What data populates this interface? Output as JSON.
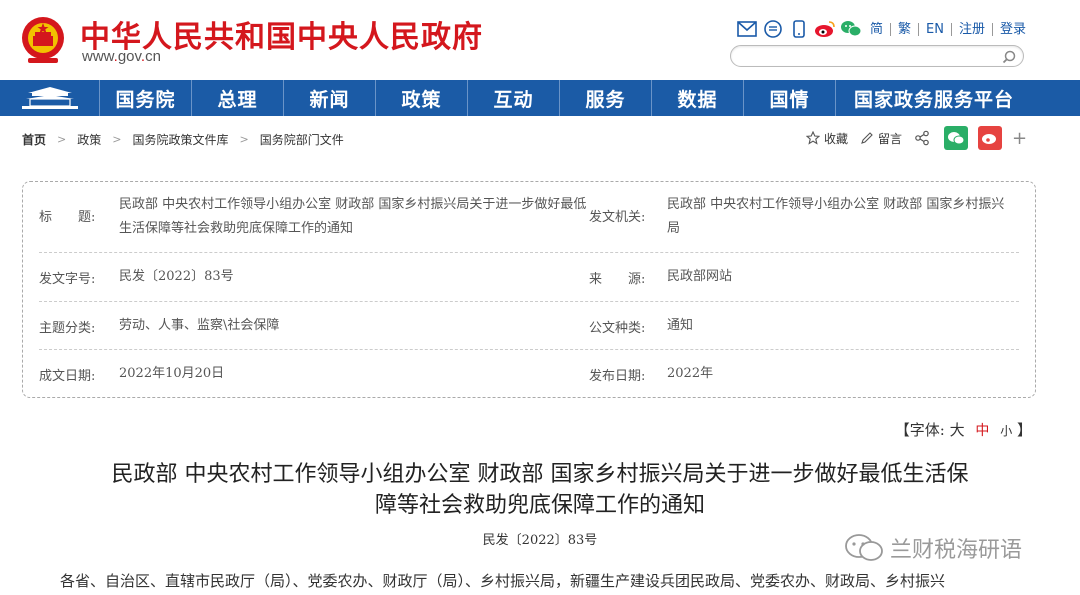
{
  "header": {
    "site_title": "中华人民共和国中央人民政府",
    "url_www": "www",
    "url_dot1": ".",
    "url_gov": "gov",
    "url_dot2": ".",
    "url_cn": "cn",
    "lang_simplified": "简",
    "lang_traditional": "繁",
    "lang_en": "EN",
    "register": "注册",
    "login": "登录",
    "search_placeholder": ""
  },
  "nav": {
    "items": [
      "国务院",
      "总理",
      "新闻",
      "政策",
      "互动",
      "服务",
      "数据",
      "国情",
      "国家政务服务平台"
    ]
  },
  "breadcrumb": {
    "items": [
      "首页",
      "政策",
      "国务院政策文件库",
      "国务院部门文件"
    ]
  },
  "tools": {
    "favorite": "收藏",
    "comment": "留言"
  },
  "info": {
    "title_label": "标　　题:",
    "title_value": "民政部 中央农村工作领导小组办公室 财政部 国家乡村振兴局关于进一步做好最低生活保障等社会救助兜底保障工作的通知",
    "issuer_label": "发文机关:",
    "issuer_value": "民政部 中央农村工作领导小组办公室 财政部 国家乡村振兴局",
    "docno_label": "发文字号:",
    "docno_value": "民发〔2022〕83号",
    "source_label": "来　　源:",
    "source_value": "民政部网站",
    "topic_label": "主题分类:",
    "topic_value": "劳动、人事、监察\\社会保障",
    "type_label": "公文种类:",
    "type_value": "通知",
    "written_label": "成文日期:",
    "written_value": "2022年10月20日",
    "published_label": "发布日期:",
    "published_value": "2022年"
  },
  "font_control": {
    "prefix": "【字体:",
    "large": "大",
    "medium": "中",
    "small": "小",
    "suffix": "】"
  },
  "article": {
    "title_line1": "民政部 中央农村工作领导小组办公室 财政部 国家乡村振兴局关于进一步做好最低生活保",
    "title_line2": "障等社会救助兜底保障工作的通知",
    "doc_no": "民发〔2022〕83号",
    "body_first_line": "各省、自治区、直辖市民政厅（局）、党委农办、财政厅（局）、乡村振兴局，新疆生产建设兵团民政局、党委农办、财政局、乡村振兴"
  },
  "watermark": {
    "text": "兰财税海研语"
  },
  "colors": {
    "brand_red": "#d4171d",
    "nav_blue": "#1b5ba6",
    "link_blue": "#1a5aa8"
  }
}
